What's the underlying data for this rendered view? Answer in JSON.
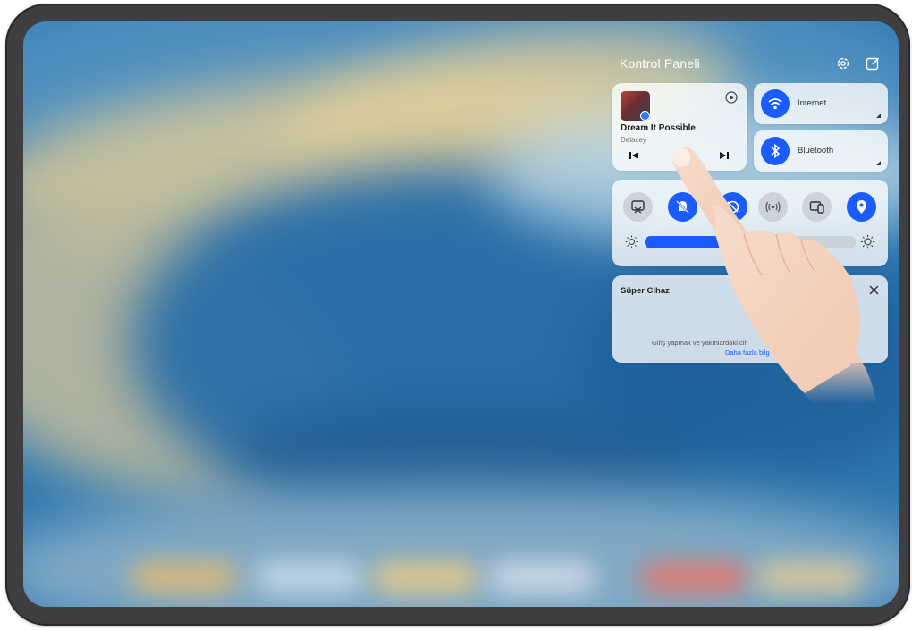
{
  "control_panel": {
    "title": "Kontrol Paneli",
    "settings_icon": "gear-icon",
    "edit_icon": "edit-icon"
  },
  "media": {
    "song_title": "Dream It Possible",
    "artist": "Delacey",
    "cast_icon": "audio-cast-icon",
    "prev_icon": "previous-track-icon",
    "next_icon": "next-track-icon"
  },
  "toggles": [
    {
      "label": "Internet",
      "icon": "wifi-icon",
      "active": true
    },
    {
      "label": "Bluetooth",
      "icon": "bluetooth-icon",
      "active": true
    }
  ],
  "switches": [
    {
      "icon": "screenshot-icon",
      "active": false
    },
    {
      "icon": "silent-icon",
      "active": true
    },
    {
      "icon": "eye-comfort-icon",
      "active": true
    },
    {
      "icon": "hotspot-icon",
      "active": false
    },
    {
      "icon": "multi-screen-icon",
      "active": false
    },
    {
      "icon": "location-icon",
      "active": true
    }
  ],
  "brightness": {
    "level": 0.42
  },
  "super_device": {
    "title": "Süper Cihaz",
    "text": "Giriş yapmak ve yakınlardaki cih",
    "link": "Daha fazla bilg"
  },
  "colors": {
    "accent": "#1a5cff",
    "bezel": "#3f3f41"
  }
}
